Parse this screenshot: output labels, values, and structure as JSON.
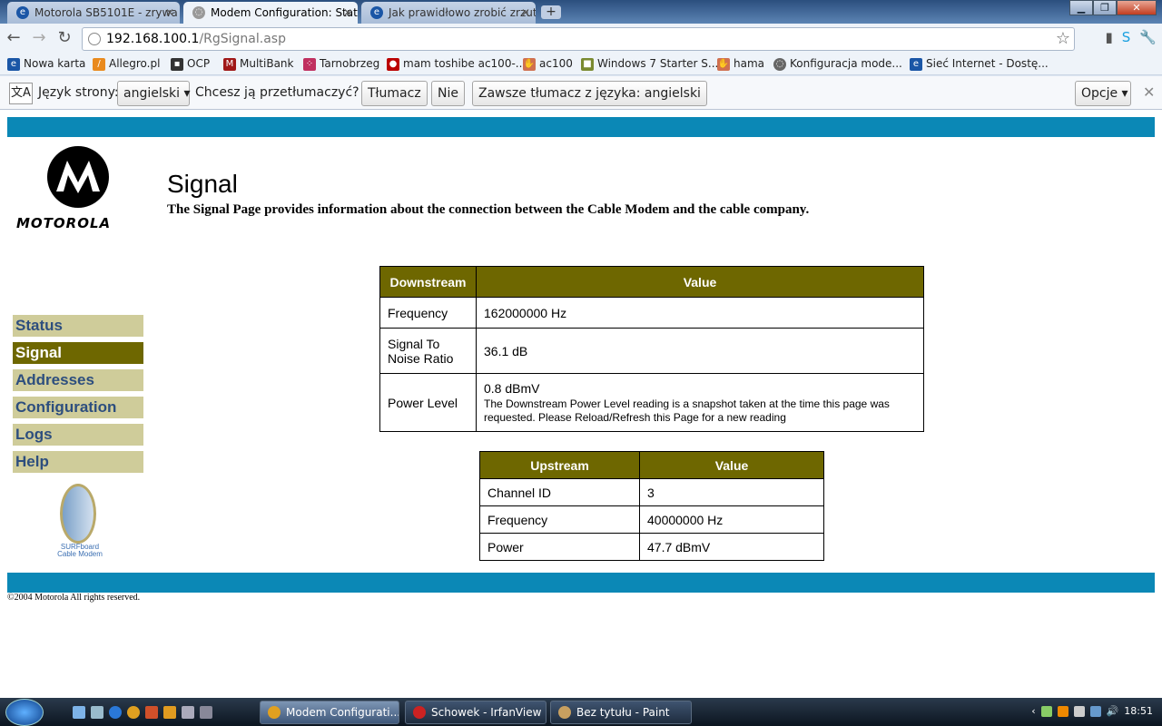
{
  "browser": {
    "tabs": [
      {
        "label": "Motorola SB5101E - zrywa p",
        "active": false
      },
      {
        "label": "Modem Configuration: Stat",
        "active": true
      },
      {
        "label": "Jak prawidłowo zrobić zrzut",
        "active": false
      }
    ],
    "new_tab": "+",
    "url_host": "192.168.100.1",
    "url_path": "/RgSignal.asp",
    "bookmarks": [
      "Nowa karta",
      "Allegro.pl",
      "OCP",
      "MultiBank",
      "Tarnobrzeg",
      "mam toshibe ac100-...",
      "ac100",
      "Windows 7 Starter S...",
      "hama",
      "Konfiguracja mode...",
      "Sieć Internet - Dostę..."
    ],
    "translate": {
      "lang_label": "Język strony:",
      "lang_value": "angielski",
      "question": "Chcesz ją przetłumaczyć?",
      "translate_btn": "Tłumacz",
      "no_btn": "Nie",
      "always_btn": "Zawsze tłumacz z języka: angielski",
      "options_btn": "Opcje"
    }
  },
  "page": {
    "logo_text": "MOTOROLA",
    "title": "Signal",
    "subtitle": "The Signal Page provides information about the connection between the Cable Modem and the cable company.",
    "menu": [
      {
        "label": "Status",
        "active": false
      },
      {
        "label": "Signal",
        "active": true
      },
      {
        "label": "Addresses",
        "active": false
      },
      {
        "label": "Configuration",
        "active": false
      },
      {
        "label": "Logs",
        "active": false
      },
      {
        "label": "Help",
        "active": false
      }
    ],
    "surfboard_text1": "SURFboard",
    "surfboard_text2": "Cable Modem",
    "downstream": {
      "header_left": "Downstream",
      "header_right": "Value",
      "rows": [
        {
          "label": "Frequency",
          "value": "162000000 Hz"
        },
        {
          "label": "Signal To Noise Ratio",
          "value": "36.1 dB"
        },
        {
          "label": "Power Level",
          "value": "0.8 dBmV",
          "note": "The Downstream Power Level reading is a snapshot taken at the time this page was requested. Please Reload/Refresh this Page for a new reading"
        }
      ]
    },
    "upstream": {
      "header_left": "Upstream",
      "header_right": "Value",
      "rows": [
        {
          "label": "Channel ID",
          "value": "3"
        },
        {
          "label": "Frequency",
          "value": "40000000 Hz"
        },
        {
          "label": "Power",
          "value": "47.7 dBmV"
        }
      ]
    },
    "footer": "©2004 Motorola    All rights reserved."
  },
  "taskbar": {
    "tasks": [
      "Modem Configurati...",
      "Schowek - IrfanView",
      "Bez tytułu - Paint"
    ],
    "clock": "18:51"
  },
  "colors": {
    "accent_blue": "#0b88b6",
    "olive": "#6e6700",
    "menu_bg": "#cfcc9a"
  }
}
